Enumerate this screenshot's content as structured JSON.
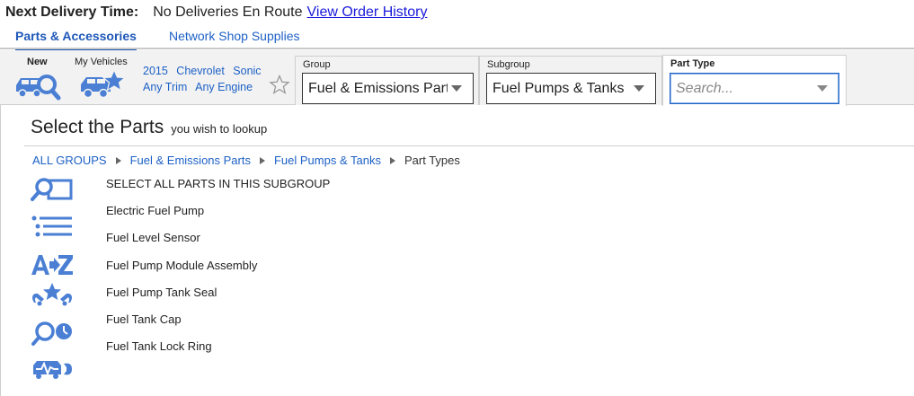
{
  "delivery": {
    "label": "Next Delivery Time:",
    "status": "No Deliveries En Route",
    "link": "View Order History"
  },
  "tabs": [
    {
      "label": "Parts & Accessories",
      "active": true
    },
    {
      "label": "Network Shop Supplies",
      "active": false
    }
  ],
  "vehicle_bar": {
    "new_label": "New",
    "my_vehicles_label": "My Vehicles",
    "year": "2015",
    "make": "Chevrolet",
    "model": "Sonic",
    "trim": "Any Trim",
    "engine": "Any Engine"
  },
  "filters": {
    "group": {
      "label": "Group",
      "value": "Fuel & Emissions Parts"
    },
    "subgroup": {
      "label": "Subgroup",
      "value": "Fuel Pumps & Tanks"
    },
    "part_type": {
      "label": "Part Type",
      "placeholder": "Search..."
    }
  },
  "title": {
    "main": "Select the Parts",
    "sub": "you wish to lookup"
  },
  "breadcrumb": [
    "ALL GROUPS",
    "Fuel & Emissions Parts",
    "Fuel Pumps & Tanks",
    "Part Types"
  ],
  "side_icons": [
    "parts-lookup-icon",
    "list-icon",
    "a-to-z-icon",
    "tools-star-icon",
    "search-clock-icon",
    "vehicle-diagnostic-icon"
  ],
  "parts": [
    "SELECT ALL PARTS IN THIS SUBGROUP",
    "Electric Fuel Pump",
    "Fuel Level Sensor",
    "Fuel Pump Module Assembly",
    "Fuel Pump Tank Seal",
    "Fuel Tank Cap",
    "Fuel Tank Lock Ring"
  ],
  "colors": {
    "accent": "#1d61c6",
    "icon": "#4a7fd4",
    "link": "#1a1adb"
  }
}
